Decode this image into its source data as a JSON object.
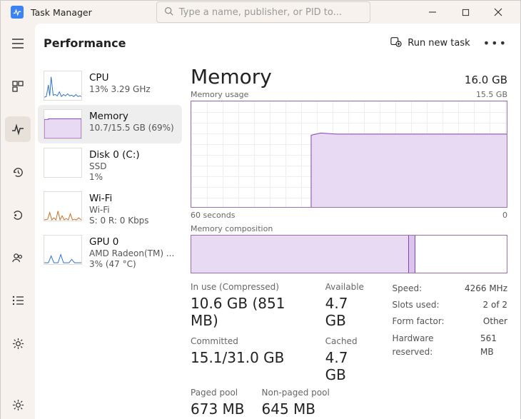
{
  "title": "Task Manager",
  "search_placeholder": "Type a name, publisher, or PID to...",
  "page_title": "Performance",
  "run_new_task_label": "Run new task",
  "sidebar": [
    {
      "title": "CPU",
      "sub1": "13% 3.29 GHz",
      "sub2": ""
    },
    {
      "title": "Memory",
      "sub1": "10.7/15.5 GB (69%)",
      "sub2": ""
    },
    {
      "title": "Disk 0 (C:)",
      "sub1": "SSD",
      "sub2": "1%"
    },
    {
      "title": "Wi-Fi",
      "sub1": "Wi-Fi",
      "sub2": "S: 0 R: 0 Kbps"
    },
    {
      "title": "GPU 0",
      "sub1": "AMD Radeon(TM) ...",
      "sub2": "3% (47 °C)"
    }
  ],
  "detail": {
    "title": "Memory",
    "total": "16.0 GB",
    "usage_label": "Memory usage",
    "usage_max": "15.5 GB",
    "x_left": "60 seconds",
    "x_right": "0",
    "composition_label": "Memory composition",
    "in_use_label": "In use (Compressed)",
    "in_use_value": "10.6 GB (851 MB)",
    "available_label": "Available",
    "available_value": "4.7 GB",
    "committed_label": "Committed",
    "committed_value": "15.1/31.0 GB",
    "cached_label": "Cached",
    "cached_value": "4.7 GB",
    "paged_label": "Paged pool",
    "paged_value": "673 MB",
    "nonpaged_label": "Non-paged pool",
    "nonpaged_value": "645 MB",
    "meta": {
      "speed_k": "Speed:",
      "speed_v": "4266 MHz",
      "slots_k": "Slots used:",
      "slots_v": "2 of 2",
      "form_k": "Form factor:",
      "form_v": "Other",
      "hw_k": "Hardware reserved:",
      "hw_v": "561 MB"
    }
  },
  "chart_data": {
    "type": "line",
    "title": "Memory usage",
    "xlabel": "seconds",
    "ylabel": "GB",
    "xlim": [
      60,
      0
    ],
    "ylim": [
      0,
      15.5
    ],
    "x": [
      60,
      37,
      36,
      0
    ],
    "values": [
      0,
      0,
      10.7,
      10.7
    ],
    "composition": {
      "in_use_fraction": 0.69,
      "modified_fraction": 0.02,
      "standby_fraction": 0.29
    }
  }
}
